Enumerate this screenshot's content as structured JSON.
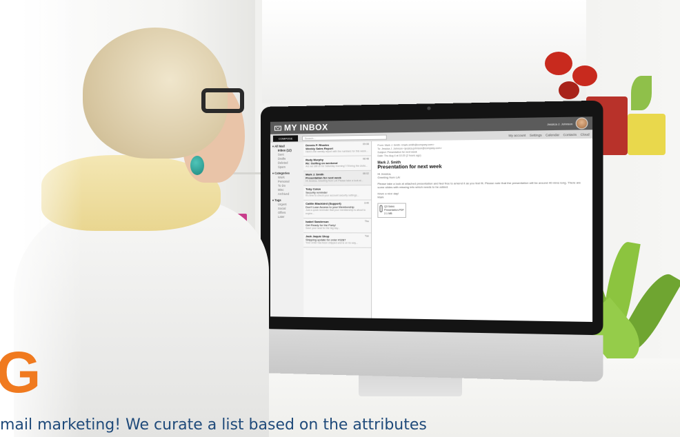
{
  "app": {
    "title": "MY INBOX",
    "user_name": "Jessica J. Johnson"
  },
  "toolbar": {
    "compose_label": "COMPOSE",
    "search_placeholder": "Search...",
    "nav": [
      "My account",
      "Settings",
      "Calendar",
      "Contacts",
      "Cloud"
    ]
  },
  "sidebar": {
    "groups": [
      {
        "label": "All Mail",
        "items": [
          "Inbox (12)",
          "Sent",
          "Drafts",
          "Deleted",
          "Spam"
        ]
      },
      {
        "label": "Categories",
        "items": [
          "Work",
          "Personal",
          "To Do",
          "Misc",
          "Archived"
        ]
      },
      {
        "label": "Tags",
        "items": [
          "Urgent",
          "Social",
          "Offers",
          "Later"
        ]
      }
    ]
  },
  "messages": [
    {
      "from": "Dennis P. Rhodes",
      "time": "09:08",
      "subject": "Weekly Sales Report",
      "preview": "Here's the weekly report with the numbers for this week..."
    },
    {
      "from": "Rudy Murphy",
      "time": "08:48",
      "subject": "Re: Golfing on weekend",
      "preview": "Are we still on for Saturday morning? I'll bring the clubs..."
    },
    {
      "from": "Mark J. Smith",
      "time": "08:02",
      "subject": "Presentation for next week",
      "preview": "Hi Jessica, Greeting from LA! Please take a look at..."
    },
    {
      "from": "Toby Colon",
      "time": "",
      "subject": "Security reminder",
      "preview": "It's time to check your account security settings..."
    },
    {
      "from": "Caitlin Blackbird (Support)",
      "time": "3:40",
      "subject": "Don't Lose Access to your Membership",
      "preview": "Just a quick reminder that your membership is about to expire..."
    },
    {
      "from": "Isabel Sanderson",
      "time": "Thu",
      "subject": "Get Ready for the Party!",
      "preview": "Save your seat for the big day..."
    },
    {
      "from": "Jack Jaquie Shop",
      "time": "Tue",
      "subject": "Shipping update for order #3287",
      "preview": "Your order has been shipped and is on its way..."
    }
  ],
  "reader": {
    "meta": [
      "From: Mark J. Smith <mark.smith@company.com>",
      "To: Jessica J. Johnson <jessica.johnson@company.com>",
      "Subject: Presentation for next week",
      "Date: Thu Aug 4 at 10:20 (2 hours ago)"
    ],
    "from": "Mark J. Smith",
    "subject": "Presentation for next week",
    "body": [
      "Hi Jessica,",
      "Greeting from LA!",
      "Please take a look at attached presentation and feel free to amend it as you feel fit. Please note that the presentation will be around 40 mins long. There are some slides with missing info which needs to be added.",
      "Have a nice day!",
      "Mark"
    ],
    "attachment": {
      "name": "Q3 Sales Presentation.PDF",
      "size": "2.1 MB"
    }
  },
  "overlay": {
    "logo_letter": "G",
    "caption": "mail marketing! We curate a list based on the attributes"
  },
  "colors": {
    "accent_orange": "#f07a1f",
    "caption_blue": "#1f4a7a",
    "app_header": "#5b5b5b"
  }
}
